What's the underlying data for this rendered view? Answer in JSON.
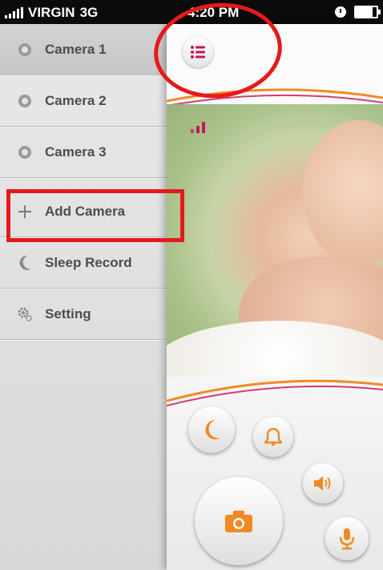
{
  "status_bar": {
    "carrier": "VIRGIN",
    "network": "3G",
    "time": "4:20 PM"
  },
  "side_menu": {
    "items": [
      {
        "label": "Camera 1",
        "icon": "camera-icon",
        "selected": true
      },
      {
        "label": "Camera 2",
        "icon": "camera-icon"
      },
      {
        "label": "Camera 3",
        "icon": "camera-icon"
      },
      {
        "label": "Add Camera",
        "icon": "plus-icon"
      },
      {
        "label": "Sleep Record",
        "icon": "moon-icon"
      },
      {
        "label": "Setting",
        "icon": "gear-icon"
      }
    ]
  },
  "main": {
    "menu_button_icon": "list-icon",
    "controls": [
      "moon-icon",
      "bell-icon",
      "speaker-icon",
      "camera-icon",
      "microphone-icon"
    ]
  },
  "colors": {
    "accent": "#f08a24",
    "brand_pink": "#c2185b",
    "highlight": "#e51a1a"
  }
}
